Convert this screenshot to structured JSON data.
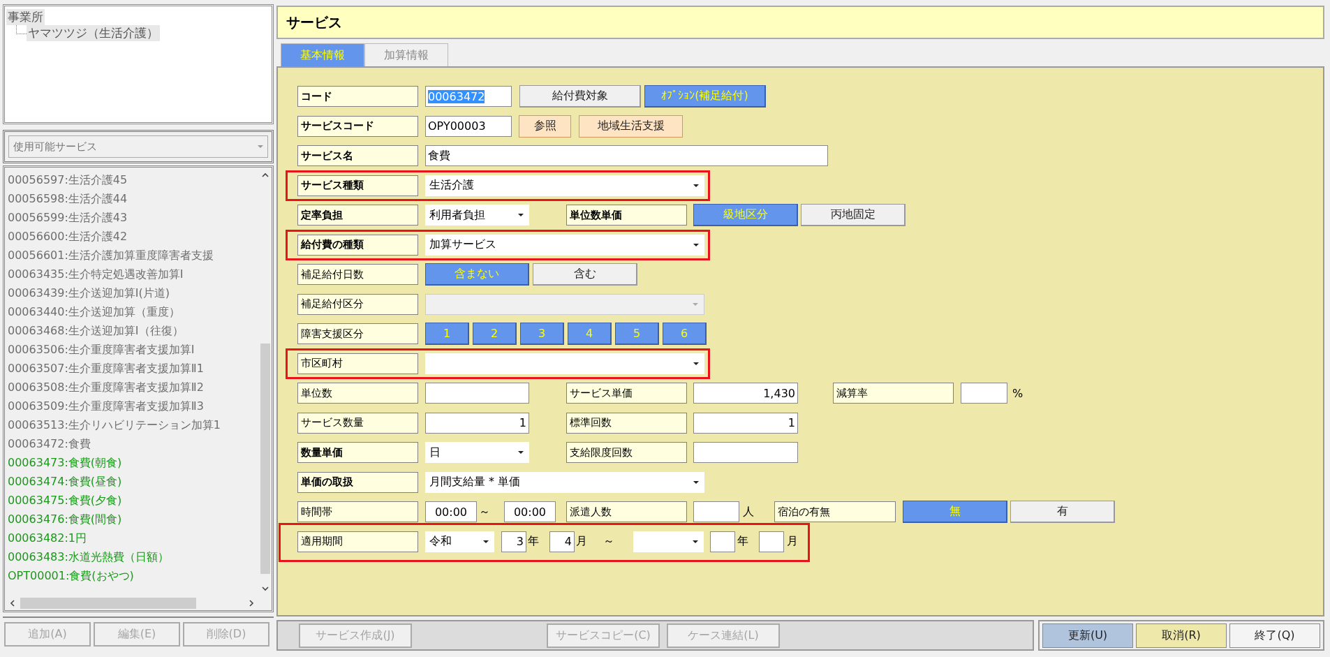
{
  "tree": {
    "label": "事業所",
    "children": [
      {
        "label": "ヤマツツジ（生活介護）"
      }
    ]
  },
  "service_filter": {
    "value": "使用可能サービス",
    "disabled": true
  },
  "service_list": [
    {
      "text": "00056597:生活介護45",
      "color": "#6e6e6e"
    },
    {
      "text": "00056598:生活介護44",
      "color": "#6e6e6e"
    },
    {
      "text": "00056599:生活介護43",
      "color": "#6e6e6e"
    },
    {
      "text": "00056600:生活介護42",
      "color": "#6e6e6e"
    },
    {
      "text": "00056601:生活介護加算重度障害者支援",
      "color": "#6e6e6e"
    },
    {
      "text": "00063435:生介特定処遇改善加算Ⅰ",
      "color": "#6e6e6e"
    },
    {
      "text": "00063439:生介送迎加算Ⅰ(片道)",
      "color": "#6e6e6e"
    },
    {
      "text": "00063440:生介送迎加算（重度）",
      "color": "#6e6e6e"
    },
    {
      "text": "00063468:生介送迎加算Ⅰ（往復）",
      "color": "#6e6e6e"
    },
    {
      "text": "00063506:生介重度障害者支援加算Ⅰ",
      "color": "#6e6e6e"
    },
    {
      "text": "00063507:生介重度障害者支援加算Ⅱ1",
      "color": "#6e6e6e"
    },
    {
      "text": "00063508:生介重度障害者支援加算Ⅱ2",
      "color": "#6e6e6e"
    },
    {
      "text": "00063509:生介重度障害者支援加算Ⅱ3",
      "color": "#6e6e6e"
    },
    {
      "text": "00063513:生介リハビリテーション加算1",
      "color": "#6e6e6e"
    },
    {
      "text": "00063472:食費",
      "color": "#6e6e6e"
    },
    {
      "text": "00063473:食費(朝食)",
      "color": "#189a18"
    },
    {
      "text": "00063474:食費(昼食)",
      "color": "#189a18"
    },
    {
      "text": "00063475:食費(夕食)",
      "color": "#189a18"
    },
    {
      "text": "00063476:食費(間食)",
      "color": "#189a18"
    },
    {
      "text": "00063482:1円",
      "color": "#189a18"
    },
    {
      "text": "00063483:水道光熱費（日額）",
      "color": "#189a18"
    },
    {
      "text": "OPT00001:食費(おやつ)",
      "color": "#189a18"
    }
  ],
  "left_buttons": [
    {
      "label": "追加(A)",
      "disabled": true
    },
    {
      "label": "編集(E)",
      "disabled": true
    },
    {
      "label": "削除(D)",
      "disabled": true
    }
  ],
  "title": "サービス",
  "tabs": [
    {
      "label": "基本情報",
      "selected": true
    },
    {
      "label": "加算情報",
      "selected": false
    }
  ],
  "form_rows": [
    {
      "label": "コード",
      "bold": true,
      "highlighted": false,
      "controls": [
        {
          "kind": "input",
          "value": "00063472",
          "text_selected": true
        },
        {
          "kind": "toggle",
          "label": "給付費対象",
          "selected": false
        },
        {
          "kind": "toggle",
          "label": "ｵﾌﾟｼｮﾝ(補足給付)",
          "selected": true
        }
      ]
    },
    {
      "label": "サービスコード",
      "bold": true,
      "highlighted": false,
      "controls": [
        {
          "kind": "input",
          "value": "OPY00003",
          "text_selected": false
        },
        {
          "kind": "action",
          "label": "参照"
        },
        {
          "kind": "action",
          "label": "地域生活支援"
        }
      ]
    },
    {
      "label": "サービス名",
      "bold": true,
      "highlighted": false,
      "controls": [
        {
          "kind": "input",
          "value": "食費",
          "text_selected": false
        }
      ]
    },
    {
      "label": "サービス種類",
      "bold": true,
      "highlighted": true,
      "controls": [
        {
          "kind": "select",
          "value": "生活介護",
          "disabled": false
        }
      ]
    },
    {
      "label": "定率負担",
      "bold": true,
      "highlighted": false,
      "controls": [
        {
          "kind": "select",
          "value": "利用者負担",
          "disabled": false
        },
        {
          "kind": "label",
          "text": "単位数単価",
          "bold": true
        },
        {
          "kind": "toggle",
          "label": "級地区分",
          "selected": true
        },
        {
          "kind": "toggle",
          "label": "丙地固定",
          "selected": false
        }
      ]
    },
    {
      "label": "給付費の種類",
      "bold": true,
      "highlighted": true,
      "controls": [
        {
          "kind": "select",
          "value": "加算サービス",
          "disabled": false
        }
      ]
    },
    {
      "label": "補足給付日数",
      "bold": false,
      "highlighted": false,
      "controls": [
        {
          "kind": "toggle",
          "label": "含まない",
          "selected": true
        },
        {
          "kind": "toggle",
          "label": "含む",
          "selected": false
        }
      ]
    },
    {
      "label": "補足給付区分",
      "bold": false,
      "highlighted": false,
      "controls": [
        {
          "kind": "select",
          "disabled": true
        }
      ]
    },
    {
      "label": "障害支援区分",
      "bold": false,
      "highlighted": false,
      "controls": [
        {
          "kind": "toggle",
          "label": "1",
          "selected": true
        },
        {
          "kind": "toggle",
          "label": "2",
          "selected": true
        },
        {
          "kind": "toggle",
          "label": "3",
          "selected": true
        },
        {
          "kind": "toggle",
          "label": "4",
          "selected": true
        },
        {
          "kind": "toggle",
          "label": "5",
          "selected": true
        },
        {
          "kind": "toggle",
          "label": "6",
          "selected": true
        }
      ]
    },
    {
      "label": "市区町村",
      "bold": false,
      "highlighted": true,
      "controls": [
        {
          "kind": "select",
          "disabled": false
        }
      ]
    },
    {
      "label": "単位数",
      "bold": false,
      "highlighted": false,
      "controls": [
        {
          "kind": "input"
        },
        {
          "kind": "label",
          "text": "サービス単価",
          "bold": false
        },
        {
          "kind": "number",
          "value": "1,430"
        },
        {
          "kind": "label",
          "text": "減算率",
          "bold": false
        },
        {
          "kind": "input"
        },
        {
          "kind": "unit",
          "text": "%"
        }
      ]
    },
    {
      "label": "サービス数量",
      "bold": false,
      "highlighted": false,
      "controls": [
        {
          "kind": "number",
          "value": "1"
        },
        {
          "kind": "label",
          "text": "標準回数",
          "bold": false
        },
        {
          "kind": "number",
          "value": "1"
        }
      ]
    },
    {
      "label": "数量単価",
      "bold": true,
      "highlighted": false,
      "controls": [
        {
          "kind": "select",
          "value": "日",
          "disabled": false
        },
        {
          "kind": "label",
          "text": "支給限度回数",
          "bold": false
        },
        {
          "kind": "input"
        }
      ]
    },
    {
      "label": "単価の取扱",
      "bold": true,
      "highlighted": false,
      "controls": [
        {
          "kind": "select",
          "value": "月間支給量 * 単価",
          "disabled": false
        }
      ]
    },
    {
      "label": "時間帯",
      "bold": false,
      "highlighted": false,
      "controls": [
        {
          "kind": "time",
          "value": "00:00"
        },
        {
          "kind": "unit",
          "text": "～"
        },
        {
          "kind": "time",
          "value": "00:00"
        },
        {
          "kind": "label",
          "text": "派遣人数",
          "bold": false
        },
        {
          "kind": "input"
        },
        {
          "kind": "unit",
          "text": "人"
        },
        {
          "kind": "label",
          "text": "宿泊の有無",
          "bold": false
        },
        {
          "kind": "toggle",
          "label": "無",
          "selected": true
        },
        {
          "kind": "toggle",
          "label": "有",
          "selected": false
        }
      ]
    },
    {
      "label": "適用期間",
      "bold": false,
      "highlighted": true,
      "controls": [
        {
          "kind": "select",
          "value": "令和",
          "disabled": false
        },
        {
          "kind": "number",
          "value": "3"
        },
        {
          "kind": "unit",
          "text": "年"
        },
        {
          "kind": "number",
          "value": "4"
        },
        {
          "kind": "unit",
          "text": "月"
        },
        {
          "kind": "unit",
          "text": "～"
        },
        {
          "kind": "select",
          "disabled": false
        },
        {
          "kind": "number"
        },
        {
          "kind": "unit",
          "text": "年"
        },
        {
          "kind": "number"
        },
        {
          "kind": "unit",
          "text": "月"
        }
      ]
    }
  ],
  "bottom_buttons": [
    {
      "label": "サービス作成(J)",
      "disabled": true
    },
    {
      "label": "サービスコピー(C)",
      "disabled": true
    },
    {
      "label": "ケース連結(L)",
      "disabled": true
    }
  ],
  "action_buttons": [
    {
      "label": "更新(U)",
      "color": "#b0c4de"
    },
    {
      "label": "取消(R)",
      "color": "#eee8aa"
    },
    {
      "label": "終了(Q)",
      "color": "#f4f4f4"
    }
  ]
}
